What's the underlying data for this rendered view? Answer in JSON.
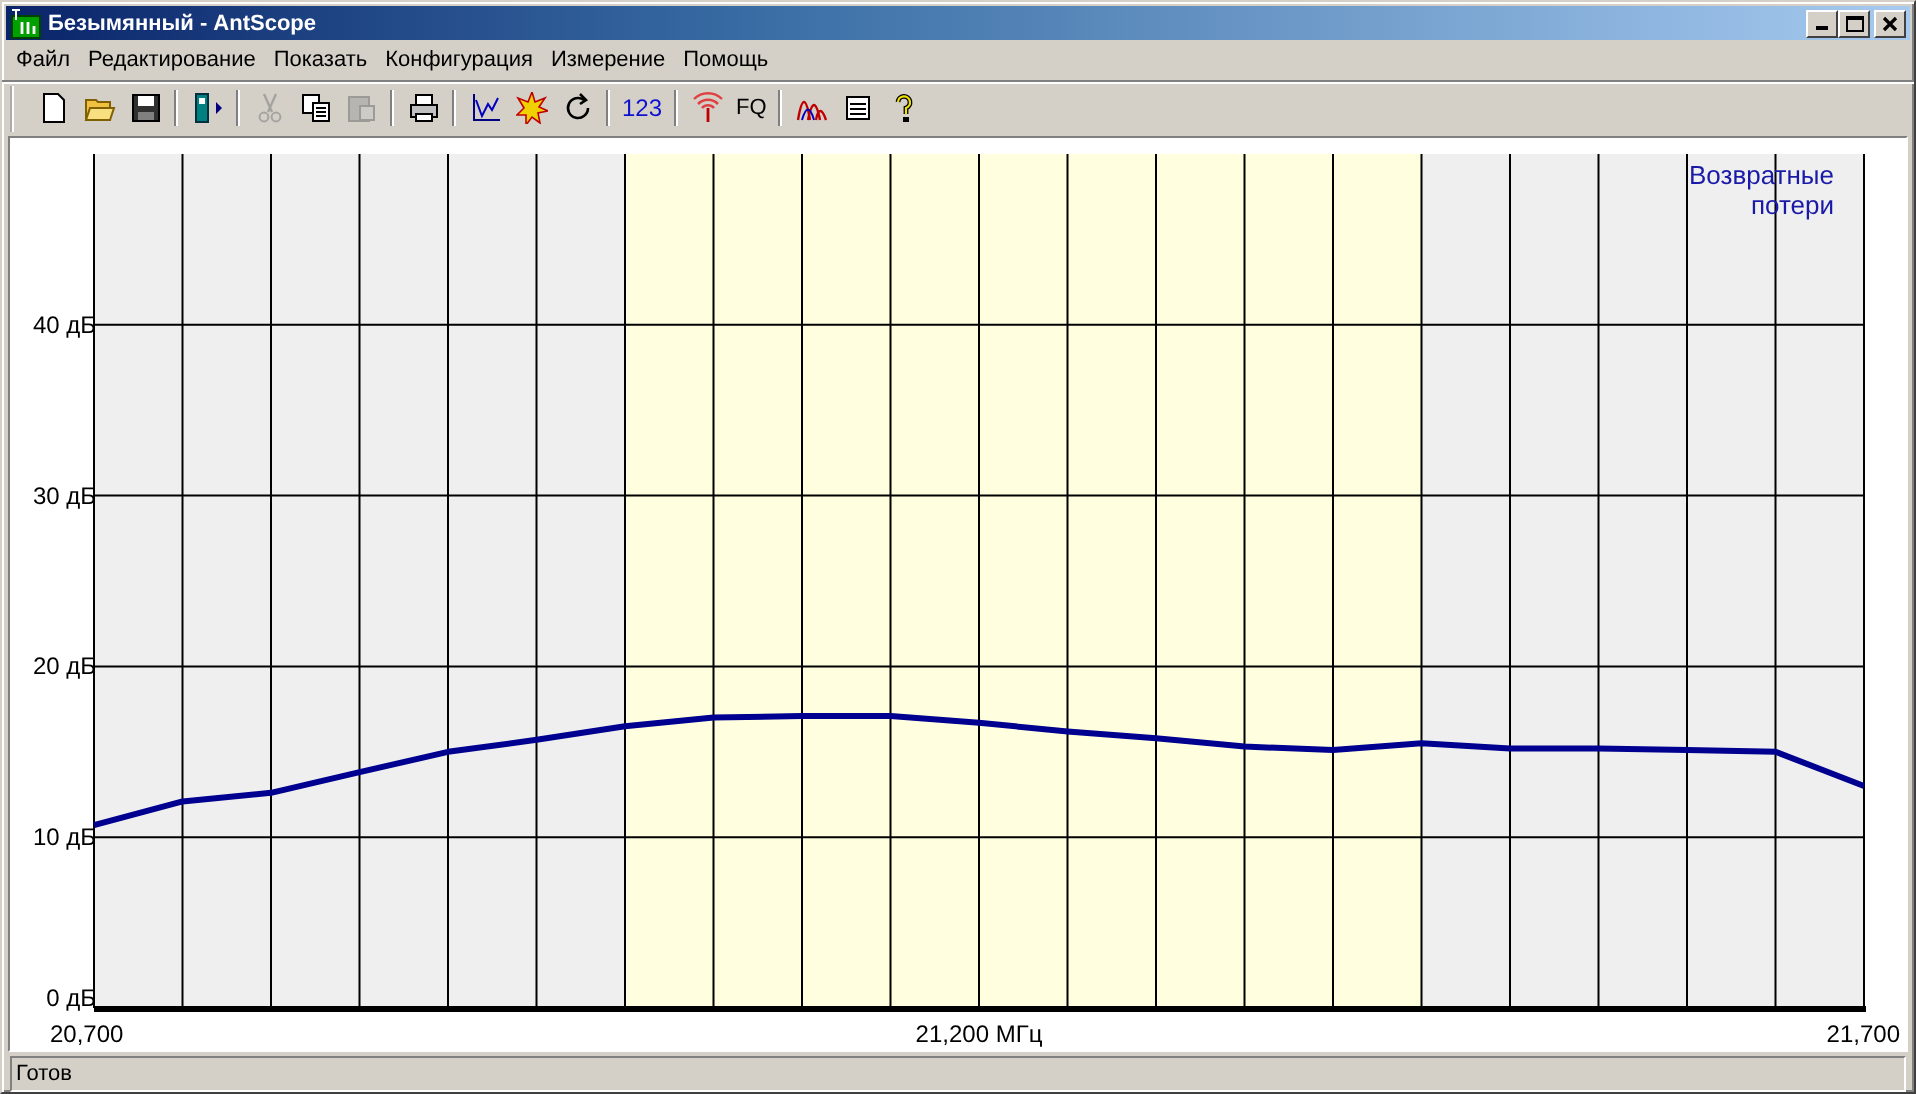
{
  "window": {
    "title": "Безымянный - AntScope"
  },
  "menu": [
    "Файл",
    "Редактирование",
    "Показать",
    "Конфигурация",
    "Измерение",
    "Помощь"
  ],
  "toolbar": [
    [
      {
        "disabled": false
      },
      {
        "disabled": false
      },
      {
        "disabled": false
      }
    ],
    [
      {
        "disabled": false
      }
    ],
    [
      {
        "disabled": true
      },
      {
        "disabled": false
      },
      {
        "disabled": true
      }
    ],
    [
      {
        "disabled": false
      }
    ],
    [
      {
        "disabled": false
      },
      {
        "disabled": false
      },
      {
        "disabled": false
      }
    ],
    [
      {
        "disabled": false,
        "label": "123"
      }
    ],
    [
      {
        "disabled": false
      },
      {
        "disabled": false,
        "label": "FQ"
      }
    ],
    [
      {
        "disabled": false
      },
      {
        "disabled": false
      },
      {
        "disabled": false
      }
    ]
  ],
  "chart": {
    "chart_data": {
      "type": "line",
      "x": [
        20700,
        20750,
        20800,
        20850,
        20900,
        20950,
        21000,
        21050,
        21100,
        21150,
        21200,
        21250,
        21300,
        21350,
        21400,
        21450,
        21500,
        21550,
        21600,
        21650,
        21700
      ],
      "series": [
        {
          "name": "Возвратные потери",
          "color": "#000090",
          "values": [
            10.7,
            12.1,
            12.6,
            13.8,
            15.0,
            15.7,
            16.5,
            17.0,
            17.1,
            17.1,
            16.7,
            16.2,
            15.8,
            15.3,
            15.1,
            15.5,
            15.2,
            15.2,
            15.1,
            15.0,
            13.0
          ]
        }
      ],
      "xlim": [
        20700,
        21700
      ],
      "ylim": [
        0,
        50
      ],
      "xticks": [
        {
          "value": 20700,
          "label": "20,700"
        },
        {
          "value": 21200,
          "label": "21,200 МГц"
        },
        {
          "value": 21700,
          "label": "21,700"
        }
      ],
      "yticks": [
        {
          "value": 0,
          "label": "0 дБ"
        },
        {
          "value": 10,
          "label": "10 дБ"
        },
        {
          "value": 20,
          "label": "20 дБ"
        },
        {
          "value": 30,
          "label": "30 дБ"
        },
        {
          "value": 40,
          "label": "40 дБ"
        }
      ],
      "bands": [
        {
          "axis": "x",
          "from": 21000,
          "to": 21450
        }
      ],
      "grid": true
    }
  },
  "status_bar": "Готов"
}
